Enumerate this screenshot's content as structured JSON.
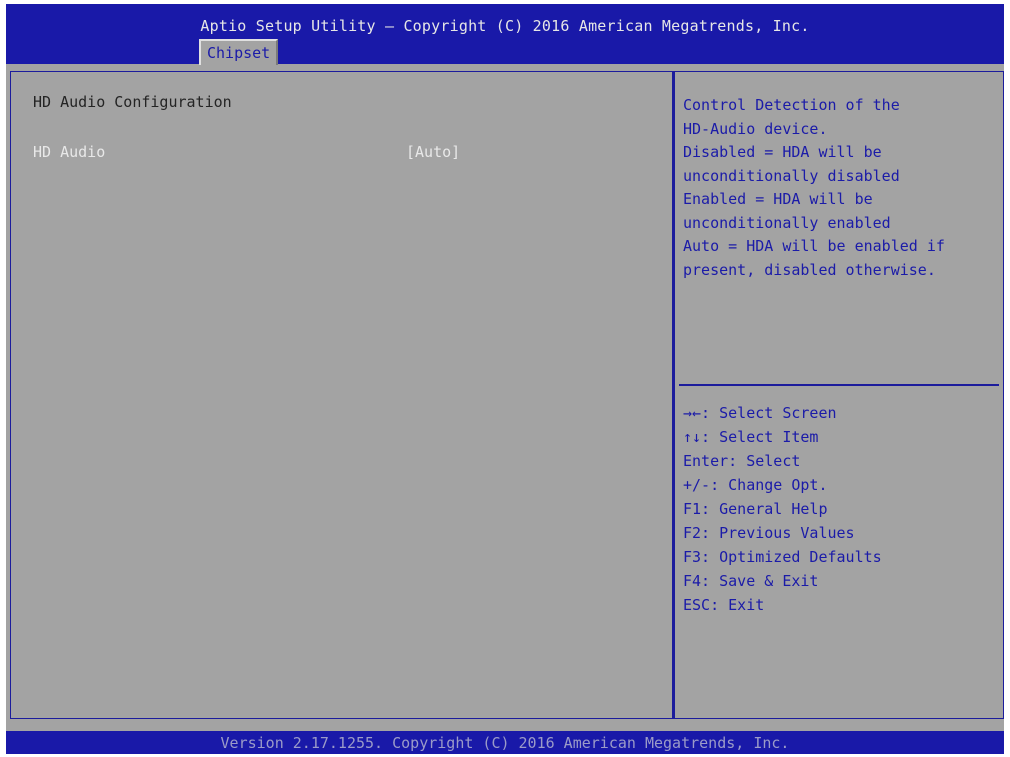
{
  "header": {
    "title": "Aptio Setup Utility – Copyright (C) 2016 American Megatrends, Inc.",
    "active_tab": "Chipset"
  },
  "main": {
    "section_title": "HD Audio Configuration",
    "settings": [
      {
        "label": "HD Audio",
        "value": "[Auto]"
      }
    ]
  },
  "help": {
    "lines": [
      "Control Detection of the",
      "HD-Audio device.",
      "Disabled = HDA will be",
      "unconditionally disabled",
      "Enabled = HDA will be",
      "unconditionally enabled",
      "Auto = HDA will be enabled if",
      "present, disabled otherwise."
    ]
  },
  "keys": {
    "lines": [
      "→←: Select Screen",
      "↑↓: Select Item",
      "Enter: Select",
      "+/-: Change Opt.",
      "F1: General Help",
      "F2: Previous Values",
      "F3: Optimized Defaults",
      "F4: Save & Exit",
      "ESC: Exit"
    ]
  },
  "footer": {
    "text": "Version 2.17.1255. Copyright (C) 2016 American Megatrends, Inc."
  },
  "colors": {
    "bar_blue": "#1919a8",
    "panel_gray": "#a3a3a3",
    "text_blue": "#1b1ba8",
    "highlight_white": "#e8e8e8"
  }
}
